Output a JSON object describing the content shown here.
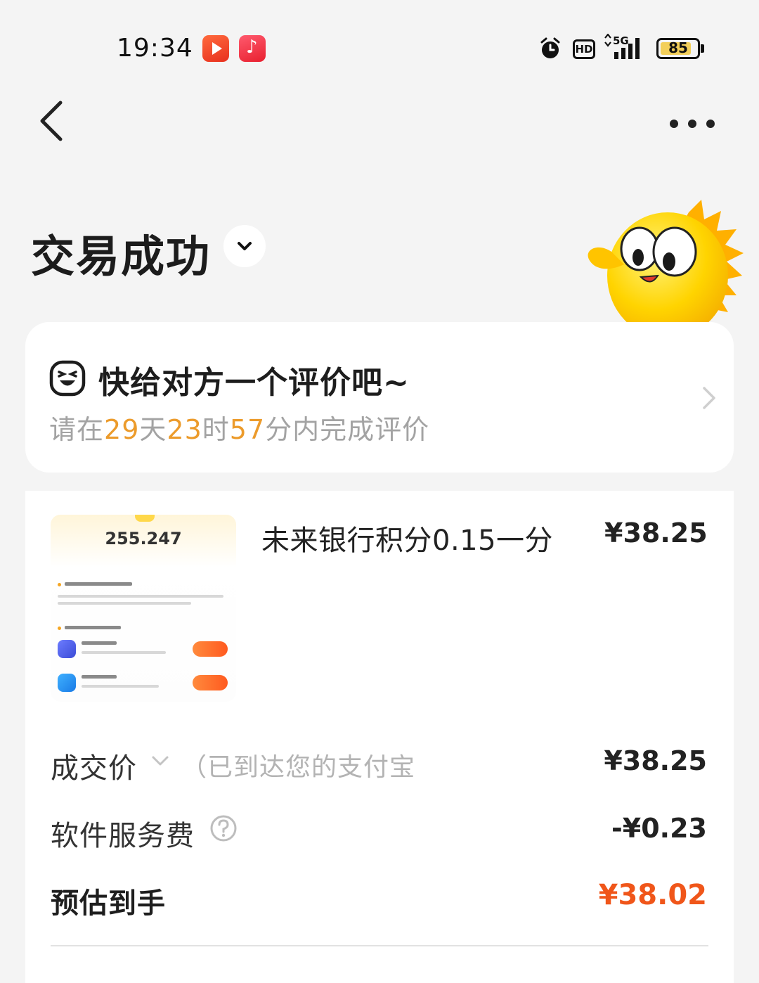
{
  "status_bar": {
    "time": "19:34",
    "app_icons": [
      "video-app-icon",
      "music-app-icon"
    ],
    "hd": "HD",
    "network": "5G",
    "battery": "85",
    "battery_level": 0.85
  },
  "nav": {
    "back_icon": "chevron-left-icon",
    "more_icon": "more-horizontal-icon"
  },
  "header": {
    "title": "交易成功"
  },
  "review_card": {
    "title": "快给对方一个评价吧~",
    "sub_prefix": "请在",
    "days": "29",
    "days_unit": "天",
    "hours": "23",
    "hours_unit": "时",
    "minutes": "57",
    "minutes_unit": "分内完成评价"
  },
  "order": {
    "thumbnail": {
      "number": "255.247"
    },
    "product_name": "未来银行积分0.15一分",
    "product_price": "¥38.25",
    "rows": {
      "deal_label": "成交价",
      "deal_note": "（已到达您的支付宝",
      "deal_value": "¥38.25",
      "fee_label": "软件服务费",
      "fee_value": "-¥0.23",
      "net_label": "预估到手",
      "net_value": "¥38.02"
    }
  },
  "colors": {
    "accent_orange": "#f0561a",
    "countdown": "#ec9b2b",
    "background": "#f4f4f4"
  }
}
